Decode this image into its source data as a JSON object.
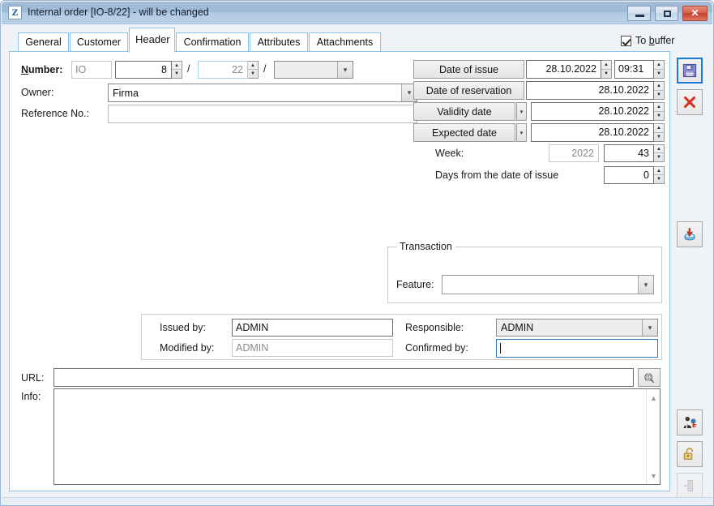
{
  "window": {
    "title": "Internal order [IO-8/22] - will be changed",
    "app_icon": "Z",
    "minimize_label": "minimize",
    "maximize_label": "maximize",
    "close_label": "✕"
  },
  "tabs": [
    {
      "label": "General",
      "active": false
    },
    {
      "label": "Customer",
      "active": false
    },
    {
      "label": "Header",
      "active": true
    },
    {
      "label": "Confirmation",
      "active": false
    },
    {
      "label": "Attributes",
      "active": false
    },
    {
      "label": "Attachments",
      "active": false
    }
  ],
  "to_buffer": {
    "label_pre": "To ",
    "label_accel": "b",
    "label_post": "uffer",
    "checked": true
  },
  "number_row": {
    "label_pre": "N",
    "label_accel": "N",
    "label": "Number:",
    "prefix_value": "IO",
    "serial_value": "8",
    "year_value": "22",
    "extra_value": ""
  },
  "owner": {
    "label": "Owner:",
    "value": "Firma"
  },
  "reference": {
    "label": "Reference No.:",
    "value": ""
  },
  "dates": {
    "date_of_issue": {
      "label": "Date of issue",
      "date": "28.10.2022",
      "time": "09:31"
    },
    "date_of_reservation": {
      "label": "Date of reservation",
      "date": "28.10.2022"
    },
    "validity_date": {
      "label": "Validity date",
      "date": "28.10.2022"
    },
    "expected_date": {
      "label": "Expected date",
      "date": "28.10.2022"
    },
    "week": {
      "label": "Week:",
      "year": "2022",
      "number": "43"
    },
    "days_from_issue": {
      "label": "Days from the date of issue",
      "value": "0"
    }
  },
  "transaction": {
    "title": "Transaction",
    "feature_label": "Feature:",
    "feature_value": ""
  },
  "people": {
    "issued_by_label": "Issued by:",
    "issued_by_value": "ADMIN",
    "modified_by_label": "Modified by:",
    "modified_by_value": "ADMIN",
    "responsible_label": "Responsible:",
    "responsible_value": "ADMIN",
    "confirmed_by_label": "Confirmed by:",
    "confirmed_by_value": ""
  },
  "url": {
    "label": "URL:",
    "value": "",
    "browse_icon": "globe-search-icon"
  },
  "info": {
    "label": "Info:",
    "value": ""
  },
  "toolbar": [
    {
      "name": "save-button",
      "icon": "floppy-disk-icon",
      "selected": true,
      "disabled": false
    },
    {
      "name": "delete-button",
      "icon": "red-x-icon",
      "selected": false,
      "disabled": false
    },
    {
      "name": "import-button",
      "icon": "import-arrow-icon",
      "selected": false,
      "disabled": false
    },
    {
      "name": "permissions-button",
      "icon": "user-key-icon",
      "selected": false,
      "disabled": false
    },
    {
      "name": "unlock-button",
      "icon": "open-padlock-icon",
      "selected": false,
      "disabled": false
    },
    {
      "name": "pin-button",
      "icon": "pin-icon",
      "selected": false,
      "disabled": true
    }
  ],
  "colors": {
    "accent": "#1a7bd4",
    "tab_border": "#8fc3e8",
    "title_gradient_top": "#a3bcd8",
    "title_gradient_bottom": "#b9d0e8",
    "close_red": "#c4412c",
    "field_border": "#6e6e6e"
  }
}
